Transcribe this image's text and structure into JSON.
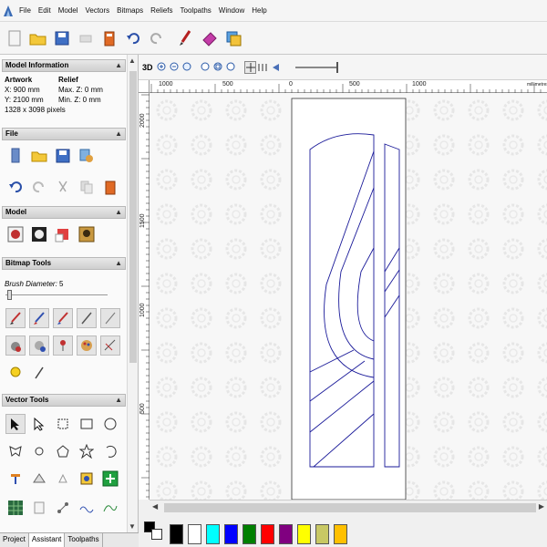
{
  "menu": [
    "File",
    "Edit",
    "Model",
    "Vectors",
    "Bitmaps",
    "Reliefs",
    "Toolpaths",
    "Window",
    "Help"
  ],
  "panels": {
    "model_info": {
      "title": "Model Information",
      "artwork_label": "Artwork",
      "artwork_x": "X: 900 mm",
      "artwork_y": "Y: 2100 mm",
      "relief_label": "Relief",
      "relief_max": "Max. Z: 0 mm",
      "relief_min": "Min. Z: 0 mm",
      "pixels": "1328 x 3098 pixels"
    },
    "file": {
      "title": "File"
    },
    "model": {
      "title": "Model"
    },
    "bitmap_tools": {
      "title": "Bitmap Tools",
      "brush_label": "Brush Diameter:",
      "brush_value": "5"
    },
    "vector_tools": {
      "title": "Vector Tools"
    }
  },
  "view": {
    "three_d_label": "3D"
  },
  "ruler": {
    "h_labels": [
      "1000",
      "500",
      "0",
      "500",
      "1000",
      "millimetres"
    ],
    "v_labels": [
      "2000",
      "1500",
      "1000",
      "500"
    ]
  },
  "tabs": [
    "Project",
    "Assistant",
    "Toolpaths"
  ],
  "active_tab": "Assistant",
  "palette": [
    "#000000",
    "#ffffff",
    "#00ffff",
    "#0000ff",
    "#008000",
    "#ff0000",
    "#800080",
    "#ffff00",
    "#c8c864",
    "#ffc000"
  ],
  "colors": {
    "vector_line": "#1a1a99",
    "canvas_bg": "#f7f7f7"
  },
  "icons": [
    "app-icon",
    "open-folder-icon",
    "save-icon",
    "toolbox-icon",
    "undo-icon",
    "redo-icon",
    "brush-icon",
    "eraser-icon",
    "layers-icon"
  ]
}
